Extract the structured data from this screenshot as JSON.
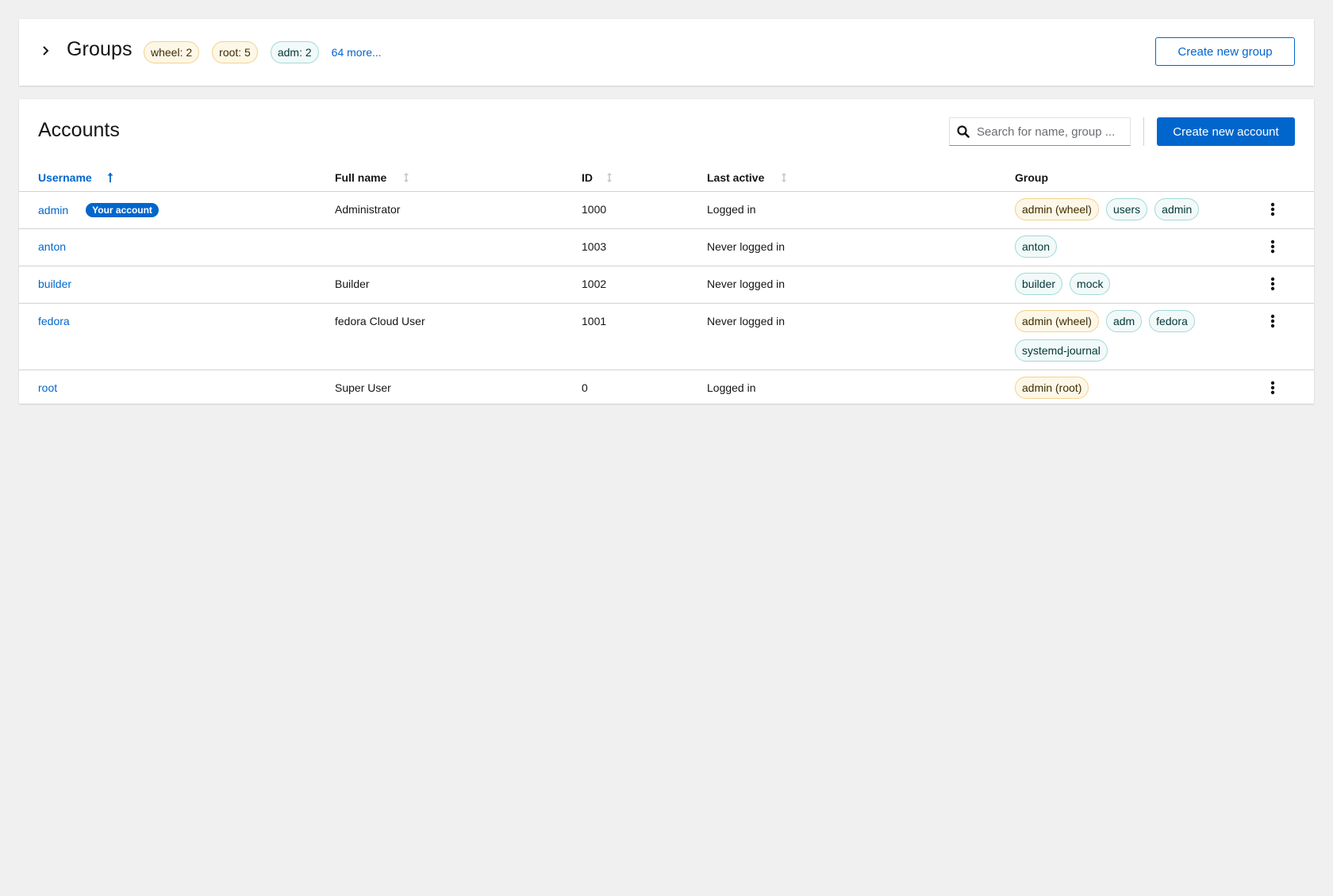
{
  "groups": {
    "title": "Groups",
    "summary": [
      {
        "label": "wheel: 2",
        "color": "gold"
      },
      {
        "label": "root: 5",
        "color": "gold"
      },
      {
        "label": "adm: 2",
        "color": "cyan"
      }
    ],
    "more_link": "64 more...",
    "create_button": "Create new group"
  },
  "accounts": {
    "title": "Accounts",
    "search_placeholder": "Search for name, group ...",
    "create_button": "Create new account",
    "columns": {
      "username": "Username",
      "full_name": "Full name",
      "id": "ID",
      "last_active": "Last active",
      "group": "Group"
    },
    "rows": [
      {
        "username": "admin",
        "badge": "Your account",
        "full_name": "Administrator",
        "id": "1000",
        "last_active": "Logged in",
        "groups": [
          {
            "label": "admin (wheel)",
            "color": "gold"
          },
          {
            "label": "users",
            "color": "cyan"
          },
          {
            "label": "admin",
            "color": "cyan"
          }
        ]
      },
      {
        "username": "anton",
        "full_name": "",
        "id": "1003",
        "last_active": "Never logged in",
        "groups": [
          {
            "label": "anton",
            "color": "cyan"
          }
        ]
      },
      {
        "username": "builder",
        "full_name": "Builder",
        "id": "1002",
        "last_active": "Never logged in",
        "groups": [
          {
            "label": "builder",
            "color": "cyan"
          },
          {
            "label": "mock",
            "color": "cyan"
          }
        ]
      },
      {
        "username": "fedora",
        "full_name": "fedora Cloud User",
        "id": "1001",
        "last_active": "Never logged in",
        "groups": [
          {
            "label": "admin (wheel)",
            "color": "gold"
          },
          {
            "label": "adm",
            "color": "cyan"
          },
          {
            "label": "fedora",
            "color": "cyan"
          },
          {
            "label": "systemd-journal",
            "color": "cyan"
          }
        ]
      },
      {
        "username": "root",
        "full_name": "Super User",
        "id": "0",
        "last_active": "Logged in",
        "groups": [
          {
            "label": "admin (root)",
            "color": "gold"
          }
        ]
      }
    ]
  },
  "icons": {
    "toggle": "chevron-right-icon",
    "search": "search-icon",
    "sort_active": "sort-ascending-icon",
    "sort_inactive": "sort-icon",
    "row_menu": "kebab-icon"
  }
}
